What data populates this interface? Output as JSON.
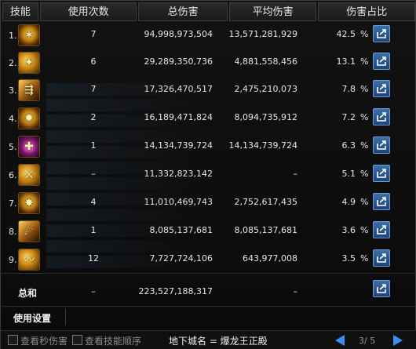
{
  "headers": {
    "skill": "技能",
    "uses": "使用次数",
    "total": "总伤害",
    "avg": "平均伤害",
    "pct": "伤害占比"
  },
  "rows": [
    {
      "index": "1.",
      "icon": "skill-icon-1",
      "uses": "7",
      "total": "94,998,973,504",
      "avg": "13,571,281,929",
      "pct": "42.5",
      "pct_sym": "%"
    },
    {
      "index": "2.",
      "icon": "skill-icon-2",
      "uses": "6",
      "total": "29,289,350,736",
      "avg": "4,881,558,456",
      "pct": "13.1",
      "pct_sym": "%"
    },
    {
      "index": "3.",
      "icon": "skill-icon-3",
      "uses": "7",
      "total": "17,326,470,517",
      "avg": "2,475,210,073",
      "pct": "7.8",
      "pct_sym": "%"
    },
    {
      "index": "4.",
      "icon": "skill-icon-4",
      "uses": "2",
      "total": "16,189,471,824",
      "avg": "8,094,735,912",
      "pct": "7.2",
      "pct_sym": "%"
    },
    {
      "index": "5.",
      "icon": "skill-icon-5",
      "uses": "1",
      "total": "14,134,739,724",
      "avg": "14,134,739,724",
      "pct": "6.3",
      "pct_sym": "%"
    },
    {
      "index": "6.",
      "icon": "skill-icon-6",
      "uses": "–",
      "total": "11,332,823,142",
      "avg": "–",
      "pct": "5.1",
      "pct_sym": "%"
    },
    {
      "index": "7.",
      "icon": "skill-icon-7",
      "uses": "4",
      "total": "11,010,469,743",
      "avg": "2,752,617,435",
      "pct": "4.9",
      "pct_sym": "%"
    },
    {
      "index": "8.",
      "icon": "skill-icon-8",
      "uses": "1",
      "total": "8,085,137,681",
      "avg": "8,085,137,681",
      "pct": "3.6",
      "pct_sym": "%"
    },
    {
      "index": "9.",
      "icon": "skill-icon-9",
      "uses": "12",
      "total": "7,727,724,106",
      "avg": "643,977,008",
      "pct": "3.5",
      "pct_sym": "%"
    }
  ],
  "total": {
    "label": "总和",
    "uses": "–",
    "total": "223,527,188,317",
    "avg": "–"
  },
  "settings": {
    "title": "使用设置"
  },
  "footer": {
    "checkbox1": "查看秒伤害",
    "checkbox2": "查看技能顺序",
    "dungeon": "地下城名 = 爆龙王正殿",
    "page": "3/ 5"
  },
  "colors": {
    "accent": "#3a8ef0",
    "share_button": "#2a5a93"
  }
}
